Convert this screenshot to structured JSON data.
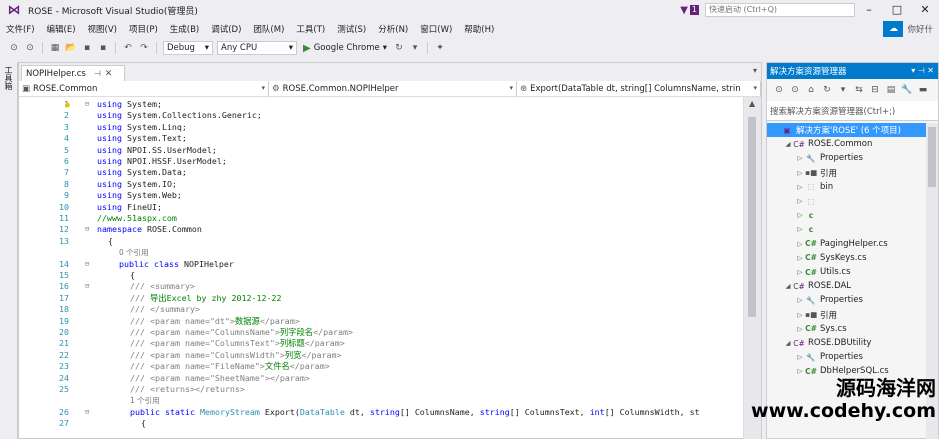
{
  "window": {
    "title": "ROSE - Microsoft Visual Studio(管理员)",
    "notification_count": "1",
    "quick_launch_placeholder": "快速启动 (Ctrl+Q)",
    "account_label": "你好什"
  },
  "menu": [
    "文件(F)",
    "编辑(E)",
    "视图(V)",
    "项目(P)",
    "生成(B)",
    "调试(D)",
    "团队(M)",
    "工具(T)",
    "测试(S)",
    "分析(N)",
    "窗口(W)",
    "帮助(H)"
  ],
  "toolbar": {
    "config": "Debug",
    "platform": "Any CPU",
    "run_target": "Google Chrome"
  },
  "left_strip_label": "工具箱",
  "editor": {
    "tab_title": "NOPIHelper.cs",
    "nav_project": "ROSE.Common",
    "nav_class": "ROSE.Common.NOPIHelper",
    "nav_member": "Export(DataTable dt, string[] ColumnsName, strin",
    "lines": [
      {
        "n": "1",
        "text": "using System;"
      },
      {
        "n": "2",
        "text": "using System.Collections.Generic;"
      },
      {
        "n": "3",
        "text": "using System.Linq;"
      },
      {
        "n": "4",
        "text": "using System.Text;"
      },
      {
        "n": "5",
        "text": "using NPOI.SS.UserModel;"
      },
      {
        "n": "6",
        "text": "using NPOI.HSSF.UserModel;"
      },
      {
        "n": "7",
        "text": "using System.Data;"
      },
      {
        "n": "8",
        "text": "using System.IO;"
      },
      {
        "n": "9",
        "text": "using System.Web;"
      },
      {
        "n": "10",
        "text": "using FineUI;"
      },
      {
        "n": "11",
        "text": "//www.51aspx.com"
      },
      {
        "n": "12",
        "text": "namespace ROSE.Common"
      },
      {
        "n": "13",
        "text": "{"
      },
      {
        "n": "",
        "text": "0 个引用"
      },
      {
        "n": "14",
        "text": "public class NOPIHelper"
      },
      {
        "n": "15",
        "text": "{"
      },
      {
        "n": "16",
        "text": "/// <summary>"
      },
      {
        "n": "17",
        "text": "/// 导出Excel by zhy 2012-12-22"
      },
      {
        "n": "18",
        "text": "/// </summary>"
      },
      {
        "n": "19",
        "text": "/// <param name=\"dt\">数据源</param>"
      },
      {
        "n": "20",
        "text": "/// <param name=\"ColumnsName\">列字段名</param>"
      },
      {
        "n": "21",
        "text": "/// <param name=\"ColumnsText\">列标题</param>"
      },
      {
        "n": "22",
        "text": "/// <param name=\"ColumnsWidth\">列宽</param>"
      },
      {
        "n": "23",
        "text": "/// <param name=\"FileName\">文件名</param>"
      },
      {
        "n": "24",
        "text": "/// <param name=\"SheetName\"></param>"
      },
      {
        "n": "25",
        "text": "/// <returns></returns>"
      },
      {
        "n": "",
        "text": "1 个引用"
      },
      {
        "n": "26",
        "text": "public static MemoryStream Export(DataTable dt, string[] ColumnsName, string[] ColumnsText, int[] ColumnsWidth, st"
      },
      {
        "n": "27",
        "text": "{"
      }
    ]
  },
  "solution_explorer": {
    "title": "解决方案资源管理器",
    "search_placeholder": "搜索解决方案资源管理器(Ctrl+;)",
    "tree": [
      {
        "label": "解决方案'ROSE' (6 个项目)",
        "indent": 0,
        "icon": "sol",
        "glyph": "▣",
        "tri": "",
        "selected": true
      },
      {
        "label": "ROSE.Common",
        "indent": 1,
        "icon": "proj",
        "glyph": "C#",
        "tri": "◢",
        "selected": false
      },
      {
        "label": "Properties",
        "indent": 2,
        "icon": "prop",
        "glyph": "🔧",
        "tri": "▷",
        "selected": false
      },
      {
        "label": "引用",
        "indent": 2,
        "icon": "ref",
        "glyph": "▪■",
        "tri": "▷",
        "selected": false
      },
      {
        "label": "bin",
        "indent": 2,
        "icon": "folder",
        "glyph": "⬚",
        "tri": "▷",
        "selected": false
      },
      {
        "label": "",
        "indent": 2,
        "icon": "folder",
        "glyph": "⬚",
        "tri": "▷",
        "selected": false
      },
      {
        "label": "",
        "indent": 2,
        "icon": "cs",
        "glyph": "c",
        "tri": "▷",
        "selected": false
      },
      {
        "label": "",
        "indent": 2,
        "icon": "cs",
        "glyph": "c",
        "tri": "▷",
        "selected": false
      },
      {
        "label": "PagingHelper.cs",
        "indent": 2,
        "icon": "cs",
        "glyph": "C#",
        "tri": "▷",
        "selected": false
      },
      {
        "label": "SysKeys.cs",
        "indent": 2,
        "icon": "cs",
        "glyph": "C#",
        "tri": "▷",
        "selected": false
      },
      {
        "label": "Utils.cs",
        "indent": 2,
        "icon": "cs",
        "glyph": "C#",
        "tri": "▷",
        "selected": false
      },
      {
        "label": "ROSE.DAL",
        "indent": 1,
        "icon": "proj",
        "glyph": "C#",
        "tri": "◢",
        "selected": false
      },
      {
        "label": "Properties",
        "indent": 2,
        "icon": "prop",
        "glyph": "🔧",
        "tri": "▷",
        "selected": false
      },
      {
        "label": "引用",
        "indent": 2,
        "icon": "ref",
        "glyph": "▪■",
        "tri": "▷",
        "selected": false
      },
      {
        "label": "Sys.cs",
        "indent": 2,
        "icon": "cs",
        "glyph": "C#",
        "tri": "▷",
        "selected": false
      },
      {
        "label": "ROSE.DBUtility",
        "indent": 1,
        "icon": "proj",
        "glyph": "C#",
        "tri": "◢",
        "selected": false
      },
      {
        "label": "Properties",
        "indent": 2,
        "icon": "prop",
        "glyph": "🔧",
        "tri": "▷",
        "selected": false
      },
      {
        "label": "DbHelperSQL.cs",
        "indent": 2,
        "icon": "cs",
        "glyph": "C#",
        "tri": "▷",
        "selected": false
      }
    ]
  },
  "watermark": {
    "cn": "源码海洋网",
    "url": "www.codehy.com"
  },
  "colors": {
    "accent": "#007acc",
    "vs_purple": "#68217a",
    "keyword": "#0000ff",
    "type": "#2b91af",
    "comment": "#008000"
  }
}
